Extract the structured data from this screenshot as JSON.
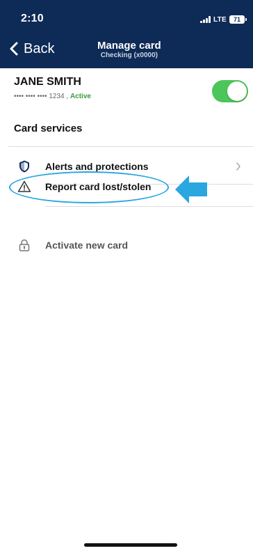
{
  "status_bar": {
    "time": "2:10",
    "network": "LTE",
    "battery": "71"
  },
  "nav": {
    "back_label": "Back",
    "title": "Manage card",
    "subtitle": "Checking (x0000)"
  },
  "card": {
    "holder_name": "JANE SMITH",
    "masked_number": "•••• •••• •••• 1234",
    "separator": " , ",
    "status": "Active",
    "enabled": true
  },
  "services": {
    "title": "Card services",
    "items": [
      {
        "label": "Alerts and protections",
        "icon": "shield-icon"
      },
      {
        "label": "Report card lost/stolen",
        "icon": "warning-triangle-icon"
      },
      {
        "label": "Activate new card",
        "icon": "padlock-icon"
      }
    ]
  },
  "colors": {
    "header_bg": "#0e2a56",
    "toggle_on": "#4cc55a",
    "active_text": "#3a9a3e",
    "annotation": "#2aa6e0"
  }
}
